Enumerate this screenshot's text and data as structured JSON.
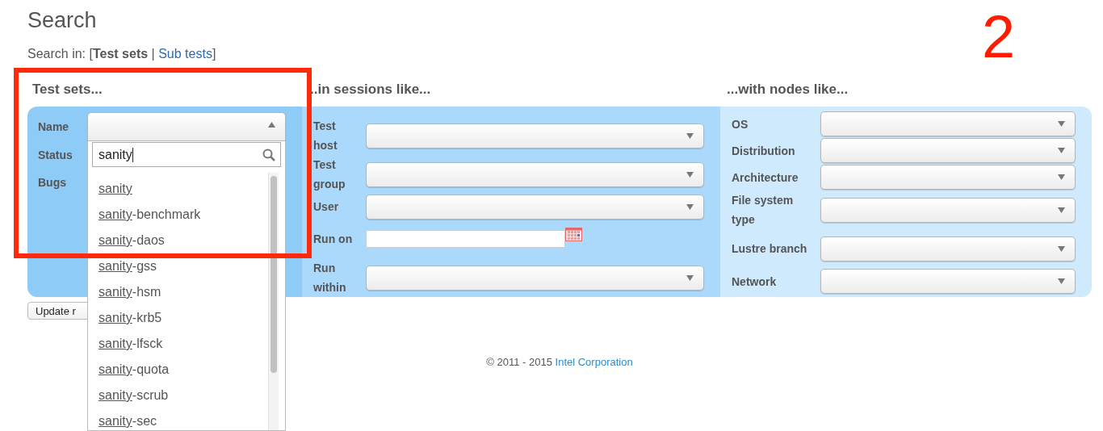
{
  "page": {
    "title": "Search"
  },
  "search_in": {
    "prefix": "Search in: [",
    "separator": " | ",
    "suffix": "]",
    "options": [
      {
        "label": "Test sets",
        "selected": true
      },
      {
        "label": "Sub tests",
        "selected": false
      }
    ]
  },
  "sections": [
    {
      "heading": "Test sets...",
      "fields": [
        {
          "label": "Name",
          "kind": "select",
          "open": true
        },
        {
          "label": "Status",
          "kind": "hidden"
        },
        {
          "label": "Bugs",
          "kind": "hidden"
        }
      ],
      "dropdown": {
        "search_value": "sanity",
        "options": [
          {
            "match": "sanity"
          },
          {
            "match": "sanity",
            "rest": "-benchmark"
          },
          {
            "match": "sanity",
            "rest": "-daos"
          },
          {
            "match": "sanity",
            "rest": "-gss"
          },
          {
            "match": "sanity",
            "rest": "-hsm"
          },
          {
            "match": "sanity",
            "rest": "-krb5"
          },
          {
            "match": "sanity",
            "rest": "-lfsck"
          },
          {
            "match": "sanity",
            "rest": "-quota"
          },
          {
            "match": "sanity",
            "rest": "-scrub"
          },
          {
            "match": "sanity",
            "rest": "-sec"
          }
        ]
      }
    },
    {
      "heading": "..in sessions like...",
      "fields": [
        {
          "label": "Test host",
          "kind": "select",
          "open": false
        },
        {
          "label": "Test group",
          "kind": "select",
          "open": false
        },
        {
          "label": "User",
          "kind": "select",
          "open": false
        },
        {
          "label": "Run on",
          "kind": "date"
        },
        {
          "label": "Run within",
          "kind": "select",
          "open": false
        }
      ]
    },
    {
      "heading": "...with nodes like...",
      "fields": [
        {
          "label": "OS",
          "kind": "select",
          "open": false
        },
        {
          "label": "Distribution",
          "kind": "select",
          "open": false
        },
        {
          "label": "Architecture",
          "kind": "select",
          "open": false
        },
        {
          "label": "File system type",
          "kind": "select",
          "open": false
        },
        {
          "label": "Lustre branch",
          "kind": "select",
          "open": false
        },
        {
          "label": "Network",
          "kind": "select",
          "open": false
        }
      ]
    }
  ],
  "update_button": {
    "label": "Update r"
  },
  "footer": {
    "text": "© 2011 - 2015 ",
    "link": "Intel Corporation"
  },
  "annotation": {
    "number": "2",
    "highlight_box": true
  }
}
